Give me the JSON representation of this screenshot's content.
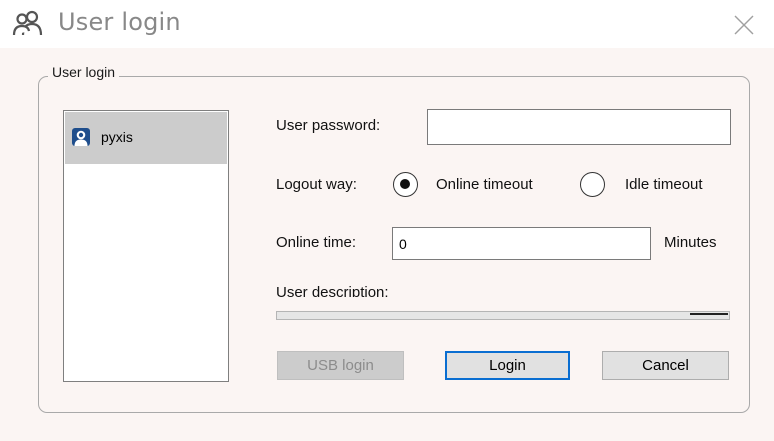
{
  "window": {
    "title": "User login",
    "title_icon": "users-icon",
    "close_icon": "close-icon"
  },
  "group": {
    "label": "User login"
  },
  "users": [
    {
      "name": "pyxis",
      "icon": "user-avatar-icon",
      "selected": true
    }
  ],
  "form": {
    "password_label": "User password:",
    "password_value": "",
    "logout_label": "Logout way:",
    "logout_options": [
      {
        "label": "Online timeout",
        "selected": true
      },
      {
        "label": "Idle timeout",
        "selected": false
      }
    ],
    "online_time_label": "Online time:",
    "online_time_value": "0",
    "online_time_unit": "Minutes",
    "description_label": "User description:"
  },
  "buttons": {
    "usb_login": "USB login",
    "login": "Login",
    "cancel": "Cancel"
  },
  "colors": {
    "accent": "#0a6ed1",
    "selection": "#cccccc",
    "background": "#fbf5f3"
  }
}
